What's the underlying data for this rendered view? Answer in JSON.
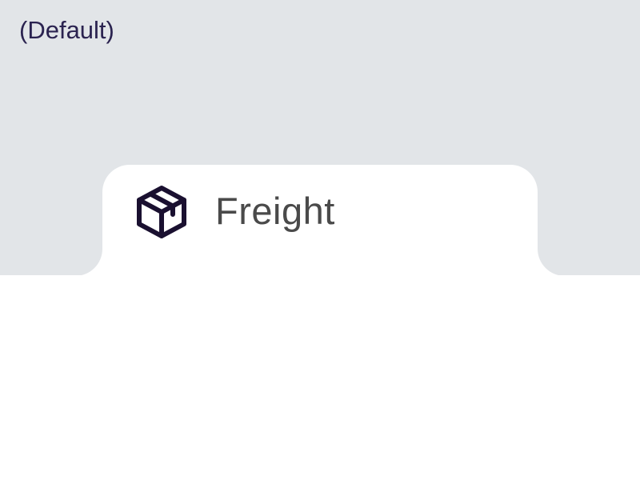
{
  "variant": {
    "label": "(Default)"
  },
  "tab": {
    "label": "Freight",
    "icon": "package-box-icon",
    "selected": true
  },
  "colors": {
    "background_band": "#e2e5e8",
    "tab_surface": "#ffffff",
    "icon_stroke": "#1a1030",
    "label_text": "#4a4a4a",
    "variant_text": "#2b2350"
  }
}
